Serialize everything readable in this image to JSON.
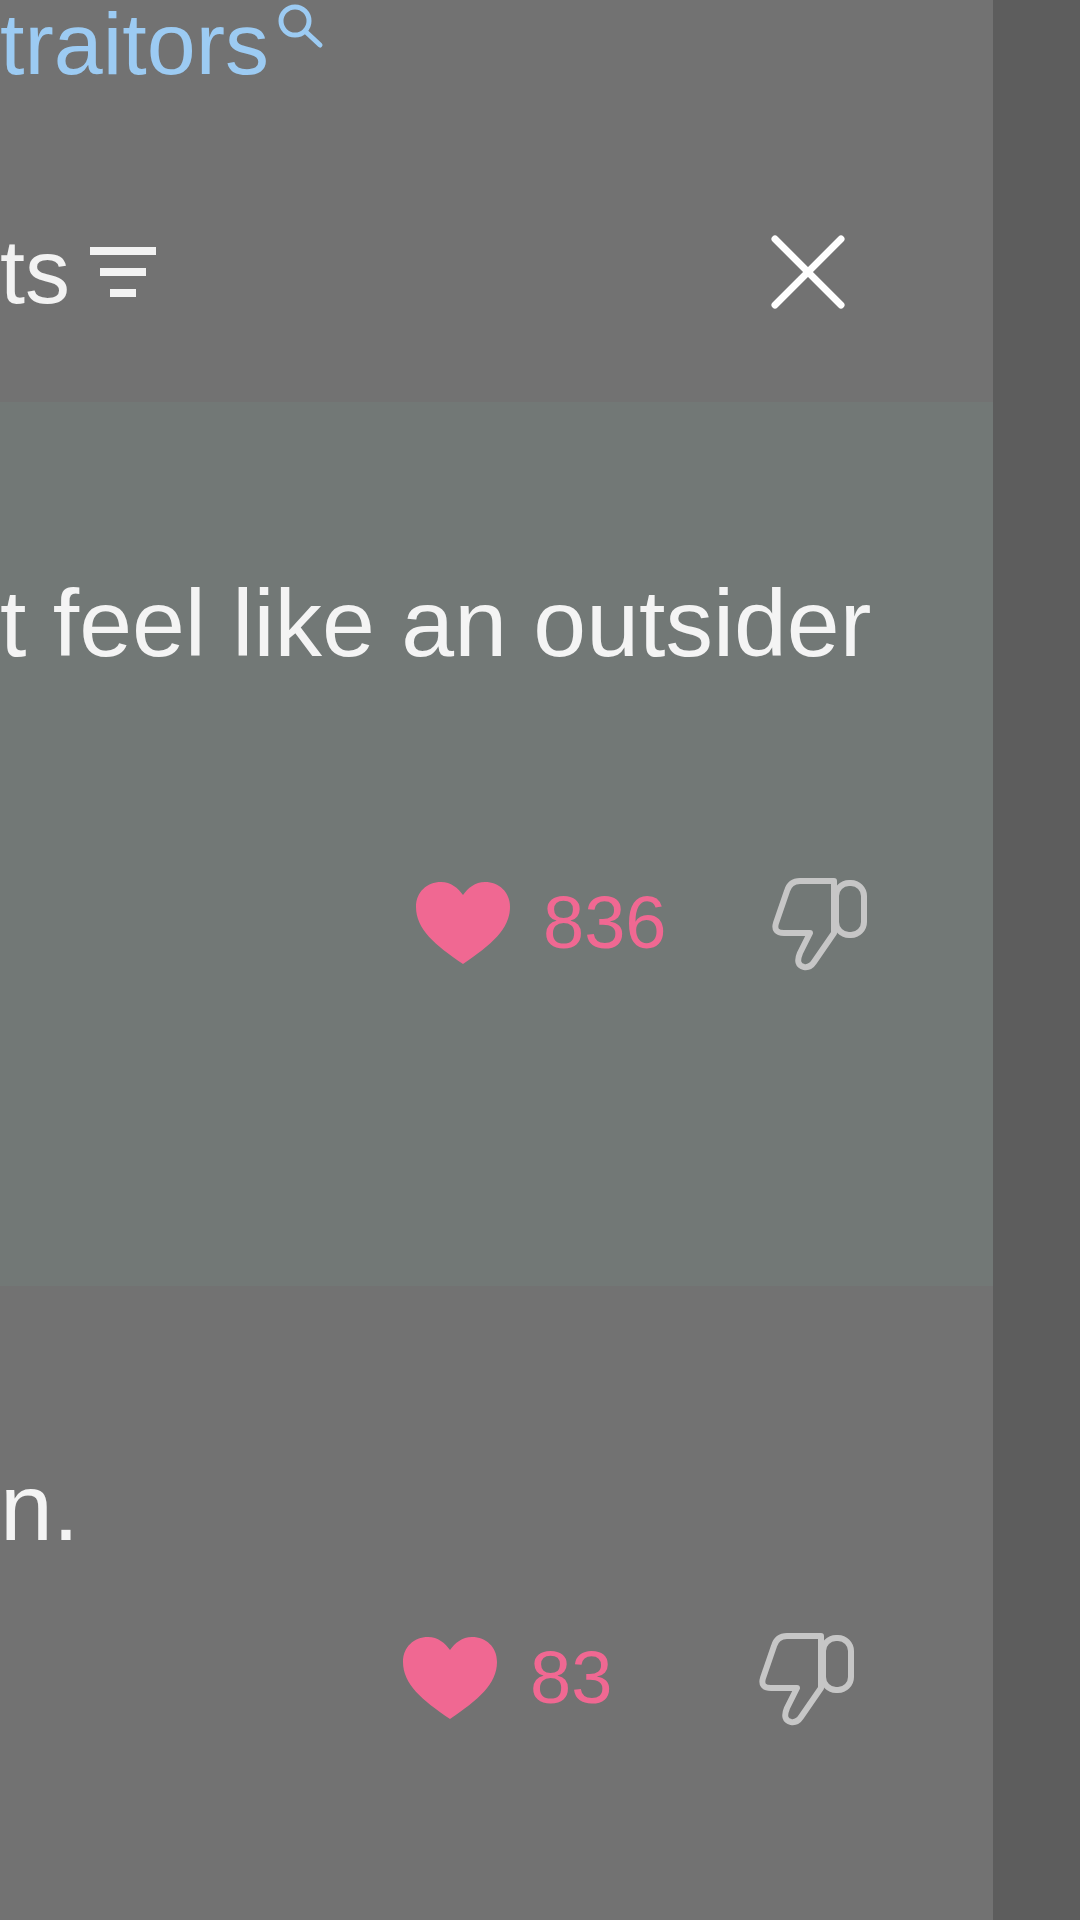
{
  "search_link": {
    "text": "traitors"
  },
  "header": {
    "title": "ts"
  },
  "comments": [
    {
      "text": "t feel like an outsider",
      "highlighted": true,
      "liked": true,
      "likes": "836"
    },
    {
      "text": "n.",
      "highlighted": false,
      "liked": true,
      "likes": "83"
    }
  ]
}
